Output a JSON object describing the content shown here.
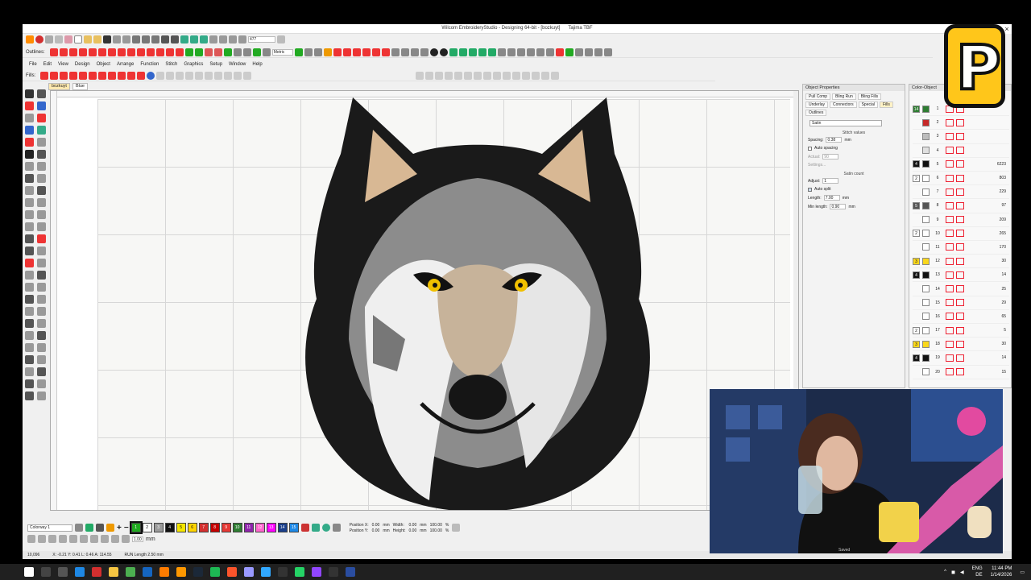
{
  "app": {
    "title": "Wilcom EmbroideryStudio - Designing 64-bit - [bozkuyt]",
    "machine": "Tajima TBF",
    "close_glyph": "×"
  },
  "qat": {
    "zoom_value": "477"
  },
  "outlines_bar": {
    "label": "Outlines:",
    "units_value": "Metric"
  },
  "menu": [
    "File",
    "Edit",
    "View",
    "Design",
    "Object",
    "Arrange",
    "Function",
    "Stitch",
    "Graphics",
    "Setup",
    "Window",
    "Help"
  ],
  "fills_bar": {
    "label": "Fills:"
  },
  "doc_tabs": [
    {
      "label": "bozkuyt",
      "active": true
    },
    {
      "label": "Blue",
      "active": false
    }
  ],
  "object_properties": {
    "title": "Object Properties",
    "tabs": [
      "Pull Comp",
      "Bling Run",
      "Bling Fills",
      "Underlay",
      "Connectors",
      "Special",
      "Fills",
      "Outlines"
    ],
    "active_tab": "Fills",
    "stitch_type": "Satin",
    "stitch_values_label": "Stitch values",
    "spacing_label": "Spacing:",
    "spacing_value": "0.38",
    "unit_mm": "mm",
    "auto_spacing_label": "Auto spacing",
    "actual_label": "Actual:",
    "actual_value": "90",
    "settings_label": "Settings...",
    "satin_count_label": "Satin count",
    "adjust_label": "Adjust:",
    "adjust_value": "1",
    "auto_split_label": "Auto split",
    "length_label": "Length:",
    "length_value": "7.00",
    "min_length_label": "Min length:",
    "min_length_value": "0.90"
  },
  "color_object_list": {
    "title": "Color-Object",
    "rows": [
      {
        "color_num": "14",
        "color": "#2e7d32",
        "obj": "1",
        "count": ""
      },
      {
        "color_num": "",
        "color": "#c62828",
        "obj": "2",
        "count": ""
      },
      {
        "color_num": "",
        "color": "#bdbdbd",
        "obj": "3",
        "count": ""
      },
      {
        "color_num": "",
        "color": "#e0e0e0",
        "obj": "4",
        "count": ""
      },
      {
        "color_num": "4",
        "color": "#111111",
        "obj": "5",
        "count": "6223"
      },
      {
        "color_num": "2",
        "color": "#ffffff",
        "obj": "6",
        "count": "803"
      },
      {
        "color_num": "",
        "color": "#ffffff",
        "obj": "7",
        "count": "229"
      },
      {
        "color_num": "5",
        "color": "#555555",
        "obj": "8",
        "count": "97"
      },
      {
        "color_num": "",
        "color": "#ffffff",
        "obj": "9",
        "count": "209"
      },
      {
        "color_num": "2",
        "color": "#ffffff",
        "obj": "10",
        "count": "265"
      },
      {
        "color_num": "",
        "color": "#ffffff",
        "obj": "11",
        "count": "170"
      },
      {
        "color_num": "3",
        "color": "#f9d71c",
        "obj": "12",
        "count": "30"
      },
      {
        "color_num": "4",
        "color": "#111111",
        "obj": "13",
        "count": "14"
      },
      {
        "color_num": "",
        "color": "#ffffff",
        "obj": "14",
        "count": "25"
      },
      {
        "color_num": "",
        "color": "#ffffff",
        "obj": "15",
        "count": "29"
      },
      {
        "color_num": "",
        "color": "#ffffff",
        "obj": "16",
        "count": "65"
      },
      {
        "color_num": "2",
        "color": "#ffffff",
        "obj": "17",
        "count": "5"
      },
      {
        "color_num": "3",
        "color": "#f9d71c",
        "obj": "18",
        "count": "30"
      },
      {
        "color_num": "4",
        "color": "#111111",
        "obj": "19",
        "count": "14"
      },
      {
        "color_num": "",
        "color": "#ffffff",
        "obj": "20",
        "count": "15"
      }
    ]
  },
  "colorway": {
    "selected": "Colorway 1",
    "swatches": [
      {
        "num": "1",
        "color": "#1faa1f"
      },
      {
        "num": "2",
        "color": "#ffffff"
      },
      {
        "num": "3",
        "color": "#9a9a9a"
      },
      {
        "num": "4",
        "color": "#111111"
      },
      {
        "num": "5",
        "color": "#f5e600"
      },
      {
        "num": "6",
        "color": "#ffd400"
      },
      {
        "num": "7",
        "color": "#d32f2f"
      },
      {
        "num": "8",
        "color": "#c40000"
      },
      {
        "num": "9",
        "color": "#e53935"
      },
      {
        "num": "10",
        "color": "#2e7d32"
      },
      {
        "num": "11",
        "color": "#8e24aa"
      },
      {
        "num": "12",
        "color": "#ff66cc"
      },
      {
        "num": "13",
        "color": "#ff00ff"
      },
      {
        "num": "14",
        "color": "#1a3e8a"
      },
      {
        "num": "15",
        "color": "#1e88e5"
      }
    ],
    "zoom_field": "1.00",
    "unit": "mm"
  },
  "position": {
    "x_label": "Position X:",
    "x_value": "0.00",
    "y_label": "Position Y:",
    "y_value": "0.00",
    "w_label": "Width:",
    "w_value": "0.00",
    "h_label": "Height:",
    "h_value": "0.00",
    "pct_w": "100.00",
    "pct_h": "100.00",
    "unit_mm": "mm",
    "unit_pct": "%"
  },
  "status": {
    "stitches": "10,096",
    "coords": "X: -0.21 Y: 0.41 L: 0.46 A: 114.55",
    "run_length": "RUN Length  2.50 mm"
  },
  "taskbar": {
    "lang_top": "ENG",
    "lang_bottom": "DE",
    "time": "11:44 PM",
    "date": "1/14/2026",
    "icons": [
      "start-icon",
      "search-icon",
      "task-view-icon",
      "edge-icon",
      "mail-icon",
      "explorer-icon",
      "chrome-icon",
      "notepad-icon",
      "illustrator-icon",
      "firefox-icon",
      "steam-icon",
      "spotify-icon",
      "brave-icon",
      "premiere-icon",
      "photoshop-icon",
      "capcut-icon",
      "whatsapp-icon",
      "stream-icon",
      "obs-icon",
      "wilcom-icon"
    ]
  },
  "webcam_label": "Saved",
  "logo_letter": "P"
}
